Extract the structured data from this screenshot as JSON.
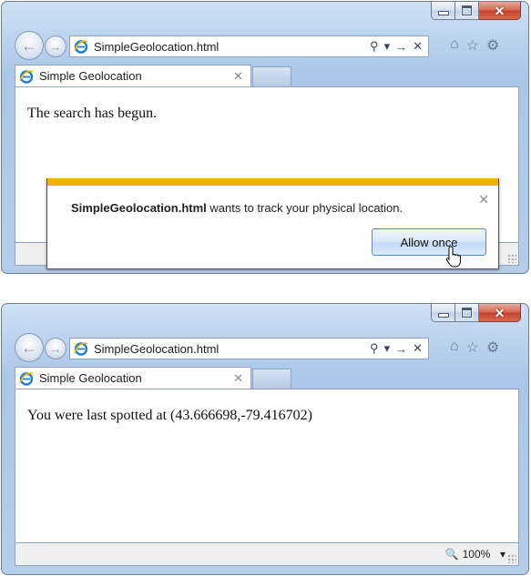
{
  "window1": {
    "address": "SimpleGeolocation.html",
    "tab_title": "Simple Geolocation",
    "page_text": "The search has begun.",
    "notification": {
      "site": "SimpleGeolocation.html",
      "message": " wants to track your physical location.",
      "button_label": "Allow once"
    }
  },
  "window2": {
    "address": "SimpleGeolocation.html",
    "tab_title": "Simple Geolocation",
    "page_text": "You were last spotted at (43.666698,-79.416702)",
    "zoom_level": "100%"
  },
  "icons": {
    "back": "back-arrow-icon",
    "forward": "forward-arrow-icon",
    "page": "ie-icon",
    "search": "search-icon",
    "refresh": "go-icon",
    "stop": "stop-icon",
    "home": "home-icon",
    "favorites": "star-icon",
    "tools": "gear-icon"
  },
  "colors": {
    "frame": "#bcd3ee",
    "notification_bar": "#f0b400",
    "close_button": "#c2432b"
  }
}
